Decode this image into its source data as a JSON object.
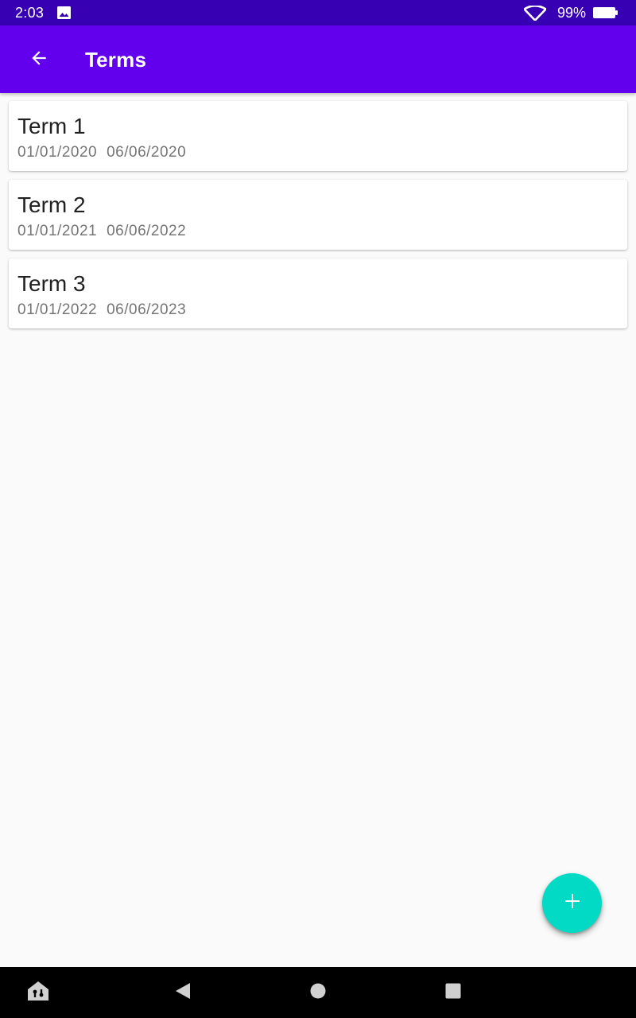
{
  "status_bar": {
    "time": "2:03",
    "battery": "99%",
    "icons": [
      "photo-icon",
      "wifi-icon",
      "battery-icon"
    ]
  },
  "app_bar": {
    "title": "Terms",
    "back_icon": "arrow-back-icon",
    "color": "#6200ee"
  },
  "terms": [
    {
      "title": "Term 1",
      "start": "01/01/2020",
      "end": "06/06/2020"
    },
    {
      "title": "Term 2",
      "start": "01/01/2021",
      "end": "06/06/2022"
    },
    {
      "title": "Term 3",
      "start": "01/01/2022",
      "end": "06/06/2023"
    }
  ],
  "fab": {
    "icon": "plus-icon",
    "color": "#03dac5"
  },
  "nav_bar": {
    "icons": [
      "home-lock-icon",
      "back-triangle-icon",
      "home-circle-icon",
      "recents-square-icon"
    ]
  },
  "colors": {
    "status_bar": "#3700b3",
    "background": "#fafafa"
  }
}
